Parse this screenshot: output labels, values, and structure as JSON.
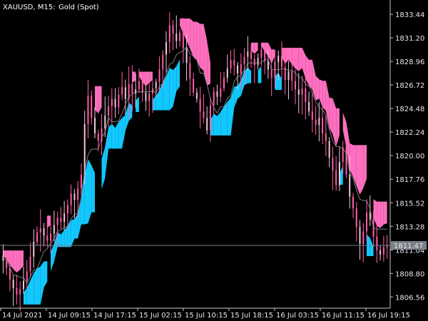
{
  "window": {
    "symbol_timeframe": "XAUUSD, M15:",
    "instrument_name": "Gold (Spot)"
  },
  "colors": {
    "background": "#000000",
    "axis": "#c8c8c8",
    "candle": "#ff5fa8",
    "candle_alt": "#f2c6da",
    "cloud_up": "#12c8ff",
    "cloud_down": "#ff6fbf",
    "signal_line": "#9a9a9a",
    "price_line": "#7a7f88",
    "price_tag_bg": "#7a7f88",
    "price_tag_text": "#ffffff"
  },
  "chart_data": {
    "type": "candlestick",
    "ylim": [
      1805.5,
      1834.8
    ],
    "y_ticks": [
      "1833.44",
      "1831.20",
      "1828.96",
      "1826.72",
      "1824.48",
      "1822.24",
      "1820.00",
      "1817.76",
      "1815.52",
      "1813.28",
      "1811.04",
      "1808.80",
      "1806.56"
    ],
    "x_ticks": [
      "14 Jul 2021",
      "14 Jul 09:15",
      "14 Jul 17:15",
      "15 Jul 02:15",
      "15 Jul 10:15",
      "15 Jul 18:15",
      "16 Jul 03:15",
      "16 Jul 11:15",
      "16 Jul 19:15"
    ],
    "current_price": "1811.47",
    "close_series": [
      1810.0,
      1809.3,
      1808.2,
      1807.4,
      1806.8,
      1807.3,
      1808.1,
      1809.0,
      1810.4,
      1811.8,
      1812.7,
      1813.1,
      1812.4,
      1811.9,
      1812.6,
      1813.4,
      1814.1,
      1813.7,
      1814.5,
      1815.3,
      1816.4,
      1815.8,
      1816.9,
      1818.2,
      1823.0,
      1825.7,
      1823.6,
      1822.1,
      1821.4,
      1822.6,
      1823.8,
      1824.7,
      1825.4,
      1824.6,
      1825.8,
      1826.5,
      1825.4,
      1826.8,
      1825.9,
      1826.3,
      1827.1,
      1826.0,
      1825.2,
      1825.9,
      1826.4,
      1827.0,
      1828.2,
      1829.6,
      1830.8,
      1832.4,
      1831.6,
      1830.9,
      1831.7,
      1830.2,
      1828.8,
      1827.3,
      1826.0,
      1825.4,
      1824.2,
      1823.6,
      1822.4,
      1824.8,
      1826.1,
      1825.6,
      1826.4,
      1827.4,
      1828.3,
      1829.1,
      1828.6,
      1827.8,
      1828.7,
      1829.4,
      1829.9,
      1829.2,
      1828.6,
      1829.3,
      1830.1,
      1829.0,
      1828.2,
      1827.4,
      1828.9,
      1829.5,
      1828.4,
      1827.2,
      1828.0,
      1827.1,
      1826.3,
      1825.8,
      1826.4,
      1825.1,
      1824.2,
      1823.4,
      1822.9,
      1823.6,
      1822.1,
      1821.4,
      1819.8,
      1818.6,
      1817.2,
      1819.4,
      1820.8,
      1818.2,
      1816.1,
      1815.0,
      1813.2,
      1811.6,
      1812.8,
      1814.6,
      1813.9,
      1812.3,
      1811.0,
      1810.6,
      1811.3,
      1811.5
    ]
  }
}
